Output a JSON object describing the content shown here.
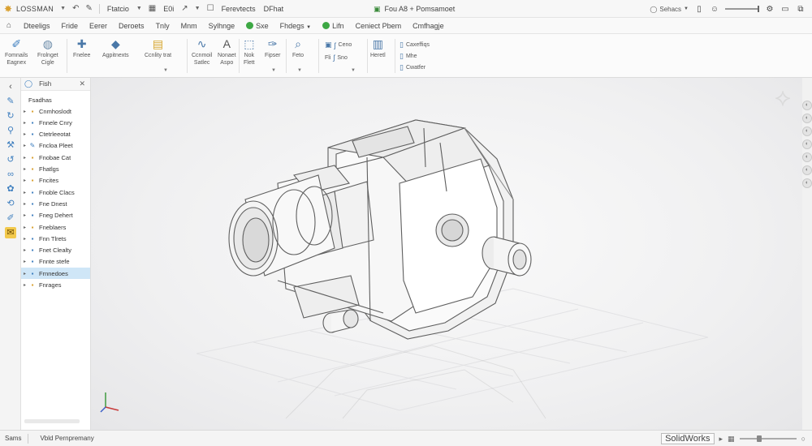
{
  "titlebar": {
    "app_name": "LOSSMAN",
    "items": [
      "Ftatcio",
      "E0i",
      "Ferevtects",
      "DFhat"
    ],
    "document_title": "Fou A8 + Pomsamoet",
    "search_label": "Sehacs"
  },
  "tabs": [
    "Dteeligs",
    "Fride",
    "Eerer",
    "Deroets",
    "Tnly",
    "Mnm",
    "Sylhnge",
    "Sxe",
    "Fhdegs",
    "Lifn",
    "Ceniect Pbem",
    "Cmfhagje"
  ],
  "ribbon": {
    "buttons": [
      {
        "label_1": "Fomnails",
        "label_2": "Eagnex"
      },
      {
        "label_1": "Frolnget",
        "label_2": "Cigle"
      },
      {
        "label_1": "Fnelee",
        "label_2": ""
      },
      {
        "label_1": "Agpitnexts",
        "label_2": ""
      },
      {
        "label_1": "Ccnlity trat",
        "label_2": ""
      },
      {
        "label_1": "Ccnmoil",
        "label_2": "Satlec"
      },
      {
        "label_1": "Nonaet",
        "label_2": "Aspo"
      },
      {
        "label_1": "Nok",
        "label_2": "Flett"
      },
      {
        "label_1": "Fipser",
        "label_2": ""
      },
      {
        "label_1": "Feto",
        "label_2": ""
      },
      {
        "label_1": "Heretl",
        "label_2": ""
      }
    ],
    "small": {
      "s1": "Ceno",
      "s2": "Fli",
      "s3": "Sno",
      "s4": "Caxeffiqs",
      "s5": "Mhe",
      "s6": "Cwatfer"
    }
  },
  "tree": {
    "header_label": "Fish",
    "root_label": "Fsadhas",
    "items": [
      {
        "label": "Cnmhoslodt",
        "icon": "folder"
      },
      {
        "label": "Fnnele Cnry",
        "icon": "part"
      },
      {
        "label": "Ctetrleeotat",
        "icon": "part"
      },
      {
        "label": "Fncloa Pleet",
        "icon": "sketch"
      },
      {
        "label": "Fnobae Cat",
        "icon": "folder"
      },
      {
        "label": "Fhatlgs",
        "icon": "folder"
      },
      {
        "label": "Fncites",
        "icon": "folder"
      },
      {
        "label": "Fnoble Clacs",
        "icon": "part"
      },
      {
        "label": "Fne Dnest",
        "icon": "part"
      },
      {
        "label": "Fneg Dehert",
        "icon": "part"
      },
      {
        "label": "Fneblaers",
        "icon": "folder"
      },
      {
        "label": "Fnn Tlrets",
        "icon": "part"
      },
      {
        "label": "Fnet Clealty",
        "icon": "part"
      },
      {
        "label": "Fnnte stefe",
        "icon": "part"
      },
      {
        "label": "Frnnedoes",
        "icon": "part"
      },
      {
        "label": "Fnrages",
        "icon": "folder"
      }
    ]
  },
  "statusbar": {
    "left_1": "Sams",
    "left_2": "Vbld Pernpremany",
    "brand": "SolidWorks"
  },
  "colors": {
    "accent": "#3f7fbf",
    "selection": "#cfe6f7",
    "active_tool": "#f2c94c",
    "green": "#3da844"
  }
}
